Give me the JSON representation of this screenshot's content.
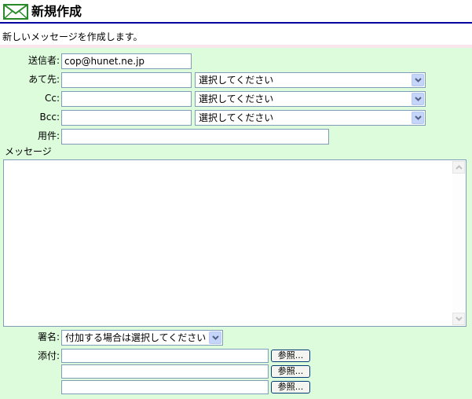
{
  "header": {
    "title": "新規作成",
    "icon": "mail-icon"
  },
  "intro": "新しいメッセージを作成します。",
  "form": {
    "from": {
      "label": "送信者:",
      "value": "cop@hunet.ne.jp"
    },
    "to": {
      "label": "あて先:",
      "value": "",
      "select": "選択してください"
    },
    "cc": {
      "label": "Cc:",
      "value": "",
      "select": "選択してください"
    },
    "bcc": {
      "label": "Bcc:",
      "value": "",
      "select": "選択してください"
    },
    "subject": {
      "label": "用件:",
      "value": ""
    },
    "message": {
      "label": "メッセージ",
      "value": ""
    },
    "signature": {
      "label": "署名:",
      "select": "付加する場合は選択してください"
    },
    "attach": {
      "label": "添付:",
      "browse_label": "参照...",
      "files": [
        "",
        "",
        ""
      ]
    }
  },
  "colors": {
    "form_bg": "#dcfcdc",
    "header_rule": "#0000a0",
    "pink_line": "#fbe6ee"
  }
}
